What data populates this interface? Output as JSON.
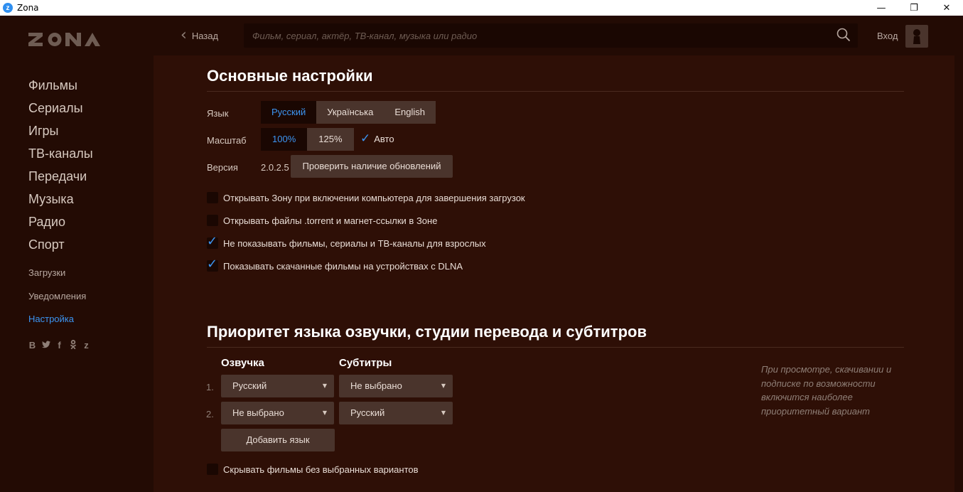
{
  "window": {
    "title": "Zona",
    "app_icon_letter": "z",
    "minimize": "—",
    "restore": "❐",
    "close": "✕"
  },
  "sidebar": {
    "logo": "ZONA",
    "main_items": [
      "Фильмы",
      "Сериалы",
      "Игры",
      "ТВ-каналы",
      "Передачи",
      "Музыка",
      "Радио",
      "Спорт"
    ],
    "sub_items": [
      {
        "label": "Загрузки",
        "active": false
      },
      {
        "label": "Уведомления",
        "active": false
      },
      {
        "label": "Настройка",
        "active": true
      }
    ],
    "social": [
      "B",
      "y",
      "f",
      "ok",
      "z"
    ]
  },
  "header": {
    "back_label": "Назад",
    "search_placeholder": "Фильм, сериал, актёр, ТВ-канал, музыка или радио",
    "search_value": "",
    "login_label": "Вход"
  },
  "settings": {
    "title": "Основные настройки",
    "language_label": "Язык",
    "languages": [
      "Русский",
      "Українська",
      "English"
    ],
    "language_selected": "Русский",
    "scale_label": "Масштаб",
    "scales": [
      "100%",
      "125%"
    ],
    "scale_selected": "100%",
    "auto_label": "Авто",
    "auto_checked": true,
    "version_label": "Версия",
    "version_value": "2.0.2.5",
    "check_updates_label": "Проверить наличие обновлений",
    "options": [
      {
        "label": "Открывать Зону при включении компьютера для завершения загрузок",
        "checked": false
      },
      {
        "label": "Открывать файлы .torrent и магнет-ссылки в Зоне",
        "checked": false
      },
      {
        "label": "Не показывать фильмы, сериалы и ТВ-каналы для взрослых",
        "checked": true
      },
      {
        "label": "Показывать скачанные фильмы на устройствах с DLNA",
        "checked": true
      }
    ]
  },
  "priority": {
    "title": "Приоритет языка озвучки, студии перевода и субтитров",
    "voice_header": "Озвучка",
    "subs_header": "Субтитры",
    "rows": [
      {
        "rank": "1.",
        "voice": "Русский",
        "subs": "Не выбрано"
      },
      {
        "rank": "2.",
        "voice": "Не выбрано",
        "subs": "Русский"
      }
    ],
    "add_language_label": "Добавить язык",
    "hint": "При просмотре, скачивании и подписке по возможности включится наиболее приоритетный вариант",
    "hide_option": {
      "label": "Скрывать фильмы без выбранных вариантов",
      "checked": false
    }
  },
  "colors": {
    "accent": "#3c95f2",
    "background": "#2e0f06",
    "sidebar": "#230b04",
    "control": "#4a342c"
  }
}
